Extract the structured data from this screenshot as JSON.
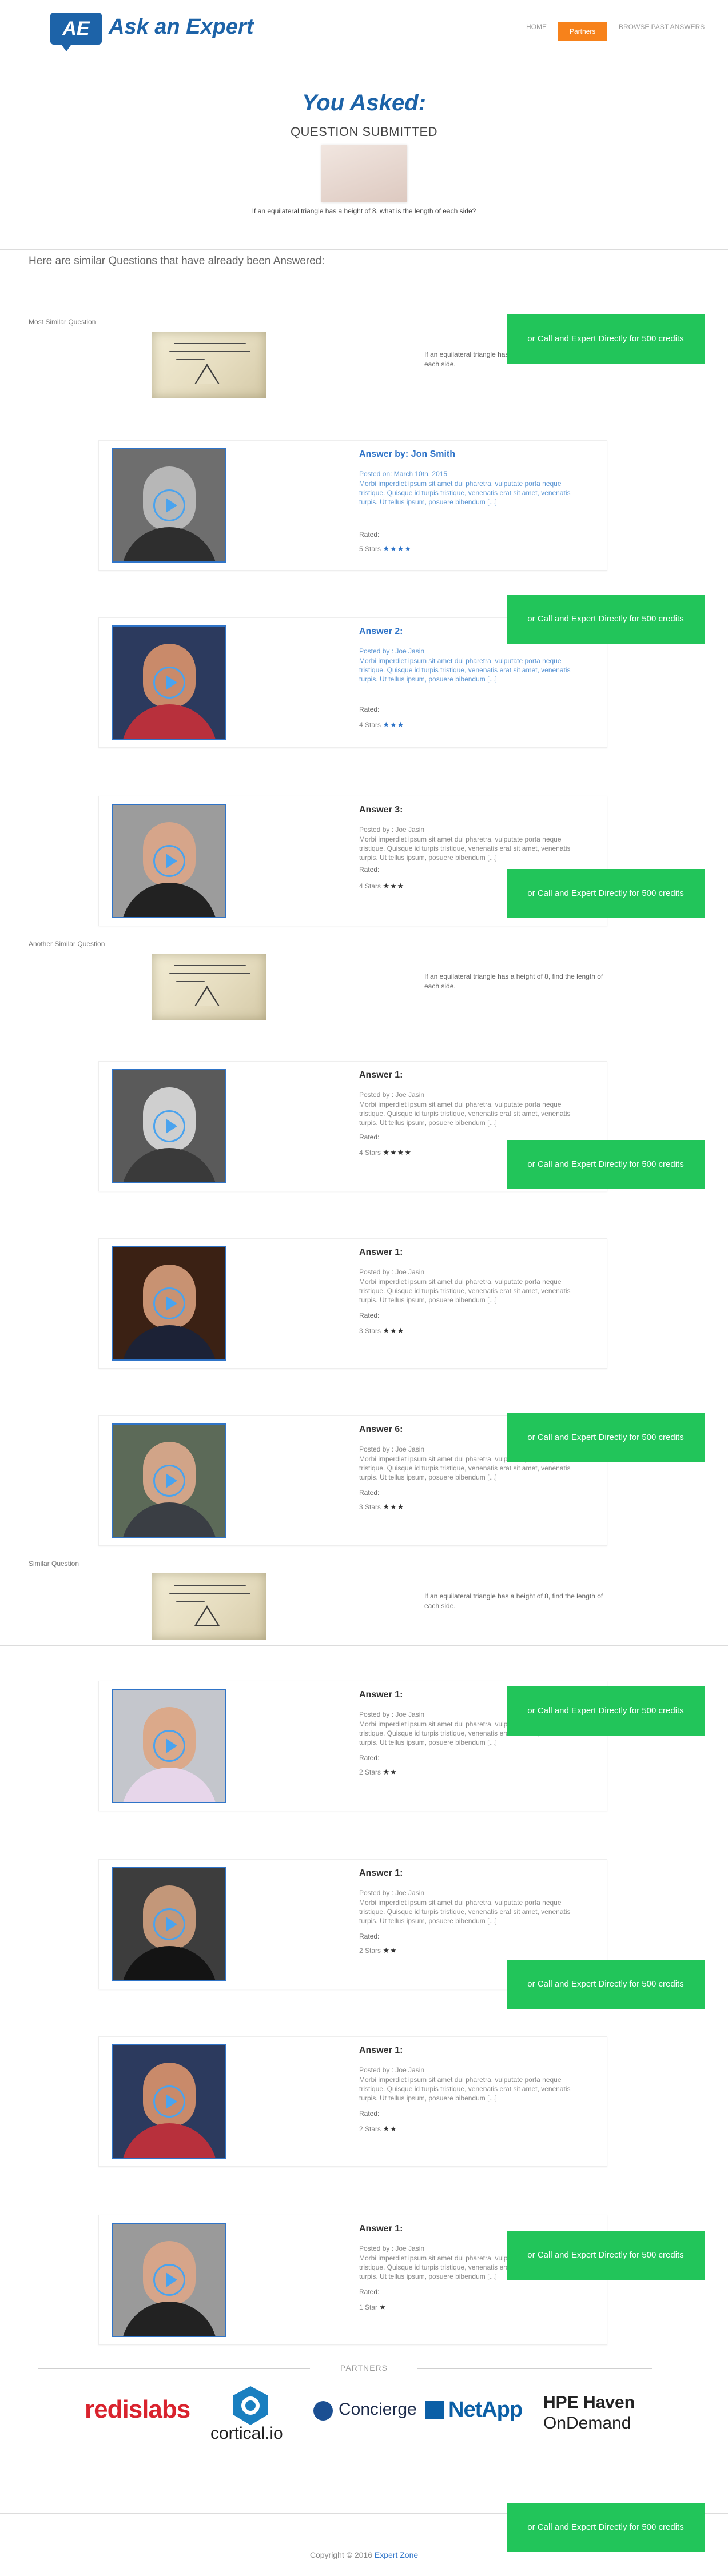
{
  "header": {
    "logo_mark": "AE",
    "logo_text": "Ask an Expert",
    "nav": {
      "home": "HOME",
      "partners": "Partners",
      "browse": "BROWSE PAST ANSWERS"
    }
  },
  "asked": {
    "title": "You Asked:",
    "status": "QUESTION SUBMITTED",
    "question": "If an equilateral triangle has a height of 8, what is the length of each side?"
  },
  "similar_heading": "Here are similar Questions that have already been Answered:",
  "cta_label": "or Call and Expert Directly for 500 credits",
  "sections": [
    {
      "label": "Most Similar Question",
      "question": "If an equilateral triangle has a height of 8, find the length of each side.",
      "answers": [
        {
          "title": "Answer by: Jon Smith",
          "posted": "Posted on: March 10th, 2015",
          "body": "Morbi imperdiet ipsum sit amet dui pharetra, vulputate porta neque tristique. Quisque id turpis tristique, venenatis erat sit amet, venenatis turpis. Ut tellus ipsum, posuere bibendum [...]",
          "rated": "Rated:",
          "stars_label": "5 Stars",
          "stars": "★★★★"
        },
        {
          "title": "Answer 2:",
          "posted": "Posted by : Joe Jasin",
          "body": "Morbi imperdiet ipsum sit amet dui pharetra, vulputate porta neque tristique. Quisque id turpis tristique, venenatis erat sit amet, venenatis turpis. Ut tellus ipsum, posuere bibendum [...]",
          "rated": "Rated:",
          "stars_label": "4 Stars",
          "stars": "★★★"
        },
        {
          "title": "Answer 3:",
          "posted": "Posted by : Joe Jasin",
          "body": "Morbi imperdiet ipsum sit amet dui pharetra, vulputate porta neque tristique. Quisque id turpis tristique, venenatis erat sit amet, venenatis turpis. Ut tellus ipsum, posuere bibendum [...]",
          "rated": "Rated:",
          "stars_label": "4 Stars",
          "stars": "★★★"
        }
      ]
    },
    {
      "label": "Another Similar Question",
      "question": "If an equilateral triangle has a height of 8, find the length of each side.",
      "answers": [
        {
          "title": "Answer 1:",
          "posted": "Posted by : Joe Jasin",
          "body": "Morbi imperdiet ipsum sit amet dui pharetra, vulputate porta neque tristique. Quisque id turpis tristique, venenatis erat sit amet, venenatis turpis. Ut tellus ipsum, posuere bibendum [...]",
          "rated": "Rated:",
          "stars_label": "4 Stars",
          "stars": "★★★★"
        },
        {
          "title": "Answer 1:",
          "posted": "Posted by : Joe Jasin",
          "body": "Morbi imperdiet ipsum sit amet dui pharetra, vulputate porta neque tristique. Quisque id turpis tristique, venenatis erat sit amet, venenatis turpis. Ut tellus ipsum, posuere bibendum [...]",
          "rated": "Rated:",
          "stars_label": "3 Stars",
          "stars": "★★★"
        },
        {
          "title": "Answer 6:",
          "posted": "Posted by : Joe Jasin",
          "body": "Morbi imperdiet ipsum sit amet dui pharetra, vulputate porta neque tristique. Quisque id turpis tristique, venenatis erat sit amet, venenatis turpis. Ut tellus ipsum, posuere bibendum [...]",
          "rated": "Rated:",
          "stars_label": "3 Stars",
          "stars": "★★★"
        }
      ]
    },
    {
      "label": "Similar Question",
      "question": "If an equilateral triangle has a height of 8, find the length of each side.",
      "answers": [
        {
          "title": "Answer 1:",
          "posted": "Posted by : Joe Jasin",
          "body": "Morbi imperdiet ipsum sit amet dui pharetra, vulputate porta neque tristique. Quisque id turpis tristique, venenatis erat sit amet, venenatis turpis. Ut tellus ipsum, posuere bibendum [...]",
          "rated": "Rated:",
          "stars_label": "2 Stars",
          "stars": "★★"
        },
        {
          "title": "Answer 1:",
          "posted": "Posted by : Joe Jasin",
          "body": "Morbi imperdiet ipsum sit amet dui pharetra, vulputate porta neque tristique. Quisque id turpis tristique, venenatis erat sit amet, venenatis turpis. Ut tellus ipsum, posuere bibendum [...]",
          "rated": "Rated:",
          "stars_label": "2 Stars",
          "stars": "★★"
        },
        {
          "title": "Answer 1:",
          "posted": "Posted by : Joe Jasin",
          "body": "Morbi imperdiet ipsum sit amet dui pharetra, vulputate porta neque tristique. Quisque id turpis tristique, venenatis erat sit amet, venenatis turpis. Ut tellus ipsum, posuere bibendum [...]",
          "rated": "Rated:",
          "stars_label": "2 Stars",
          "stars": "★★"
        },
        {
          "title": "Answer 1:",
          "posted": "Posted by : Joe Jasin",
          "body": "Morbi imperdiet ipsum sit amet dui pharetra, vulputate porta neque tristique. Quisque id turpis tristique, venenatis erat sit amet, venenatis turpis. Ut tellus ipsum, posuere bibendum [...]",
          "rated": "Rated:",
          "stars_label": "1 Star",
          "stars": "★"
        }
      ]
    }
  ],
  "partners": {
    "label": "PARTNERS",
    "logos": {
      "redis": "redislabs",
      "cortical": "cortical.io",
      "concierge": "Concierge",
      "netapp": "NetApp",
      "hpe_1": "HPE Haven",
      "hpe_2": "OnDemand"
    }
  },
  "footer": {
    "copyright": "Copyright © 2016",
    "brand": "Expert Zone"
  },
  "colors": {
    "brand_blue": "#1d63a8",
    "cta_green": "#22c55a",
    "nav_orange": "#f7821b"
  }
}
